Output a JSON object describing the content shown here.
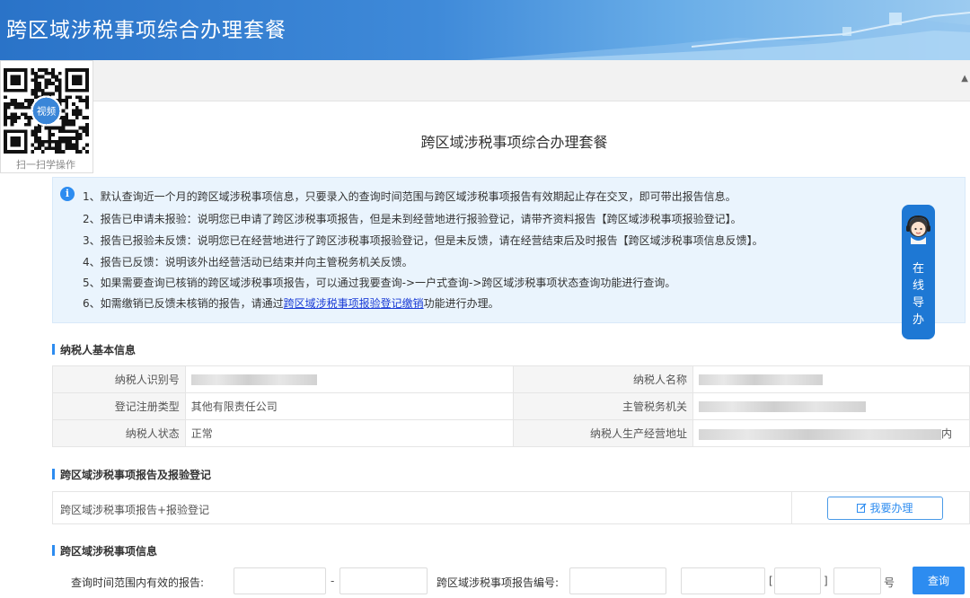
{
  "banner": {
    "title": "跨区域涉税事项综合办理套餐"
  },
  "qr": {
    "caption": "扫一扫学操作",
    "badge": "视频"
  },
  "page": {
    "title": "跨区域涉税事项综合办理套餐"
  },
  "notice": {
    "line1": "1、默认查询近一个月的跨区域涉税事项信息，只要录入的查询时间范围与跨区域涉税事项报告有效期起止存在交叉，即可带出报告信息。",
    "line2": "2、报告已申请未报验：说明您已申请了跨区涉税事项报告，但是未到经营地进行报验登记，请带齐资料报告【跨区域涉税事项报验登记】。",
    "line3": "3、报告已报验未反馈：说明您已在经营地进行了跨区涉税事项报验登记，但是未反馈，请在经营结束后及时报告【跨区域涉税事项信息反馈】。",
    "line4": "4、报告已反馈：说明该外出经营活动已结束并向主管税务机关反馈。",
    "line5": "5、如果需要查询已核销的跨区域涉税事项报告，可以通过我要查询->一户式查询->跨区域涉税事项状态查询功能进行查询。",
    "line6_prefix": "6、如需缴销已反馈未核销的报告，请通过",
    "line6_link": "跨区域涉税事项报验登记缴销",
    "line6_suffix": "功能进行办理。"
  },
  "guide": {
    "text": "在线导办"
  },
  "taxpayer_section": {
    "title": "纳税人基本信息",
    "rows": [
      {
        "label1": "纳税人识别号",
        "value1": "",
        "label2": "纳税人名称",
        "value2": ""
      },
      {
        "label1": "登记注册类型",
        "value1": "其他有限责任公司",
        "label2": "主管税务机关",
        "value2": ""
      },
      {
        "label1": "纳税人状态",
        "value1": "正常",
        "label2": "纳税人生产经营地址",
        "value2": "",
        "value2_tail": "内"
      }
    ]
  },
  "report_section": {
    "title": "跨区域涉税事项报告及报验登记",
    "row_label": "跨区域涉税事项报告+报验登记",
    "button": "我要办理",
    "button_icon": "edit-icon"
  },
  "query_section": {
    "title": "跨区域涉税事项信息",
    "range_label": "查询时间范围内有效的报告:",
    "range_separator": "-",
    "number_label": "跨区域涉税事项报告编号:",
    "bracket_open": "[",
    "bracket_close": "]",
    "number_suffix": "号",
    "button": "查询"
  },
  "colors": {
    "primary": "#2d8cf0",
    "banner": "#2a73c8",
    "notice_bg": "#eaf4fd",
    "link": "#1a3cd6"
  }
}
